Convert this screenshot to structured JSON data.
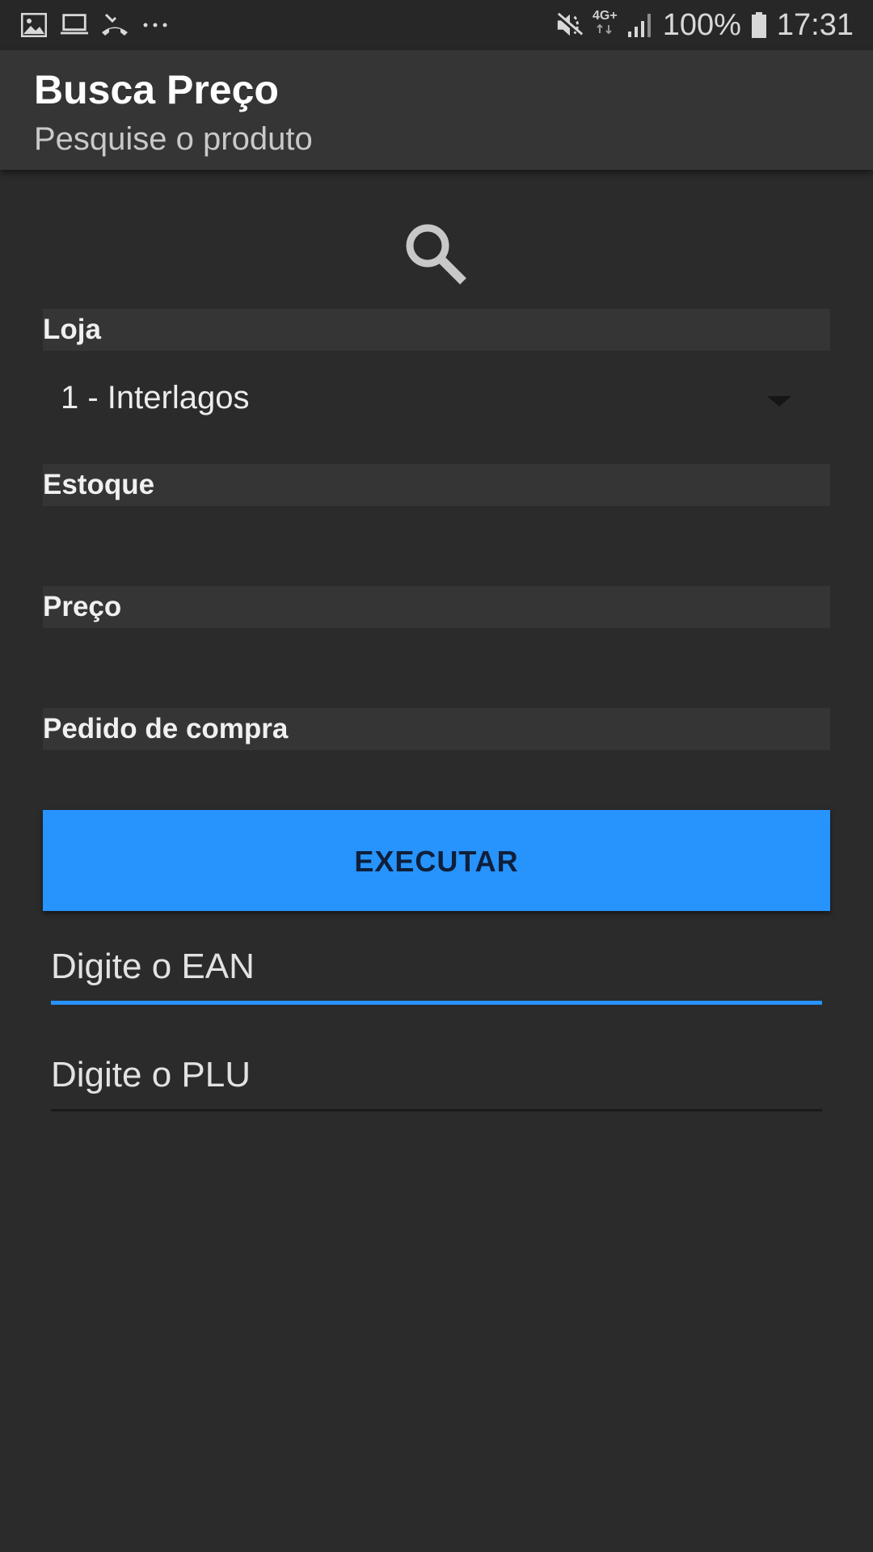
{
  "status_bar": {
    "left_icons": [
      "image-icon",
      "laptop-icon",
      "missed-call-icon",
      "more-dots-icon"
    ],
    "right_icons": [
      "mute-icon",
      "network-4g-icon",
      "signal-icon",
      "battery-icon"
    ],
    "network": "4G+",
    "battery": "100%",
    "time": "17:31"
  },
  "app_bar": {
    "title": "Busca Preço",
    "subtitle": "Pesquise o produto"
  },
  "hero_icon": "search-icon",
  "sections": {
    "loja": {
      "label": "Loja",
      "selected": "1 - Interlagos"
    },
    "estoque": {
      "label": "Estoque",
      "value": ""
    },
    "preco": {
      "label": "Preço",
      "value": ""
    },
    "pedido": {
      "label": "Pedido de compra",
      "value": ""
    }
  },
  "execute_button": {
    "label": "EXECUTAR"
  },
  "inputs": {
    "ean": {
      "placeholder": "Digite o EAN",
      "value": ""
    },
    "plu": {
      "placeholder": "Digite o PLU",
      "value": ""
    }
  },
  "colors": {
    "background": "#2b2b2b",
    "app_bar": "#353535",
    "accent": "#2793fc",
    "section_header": "#353535"
  }
}
